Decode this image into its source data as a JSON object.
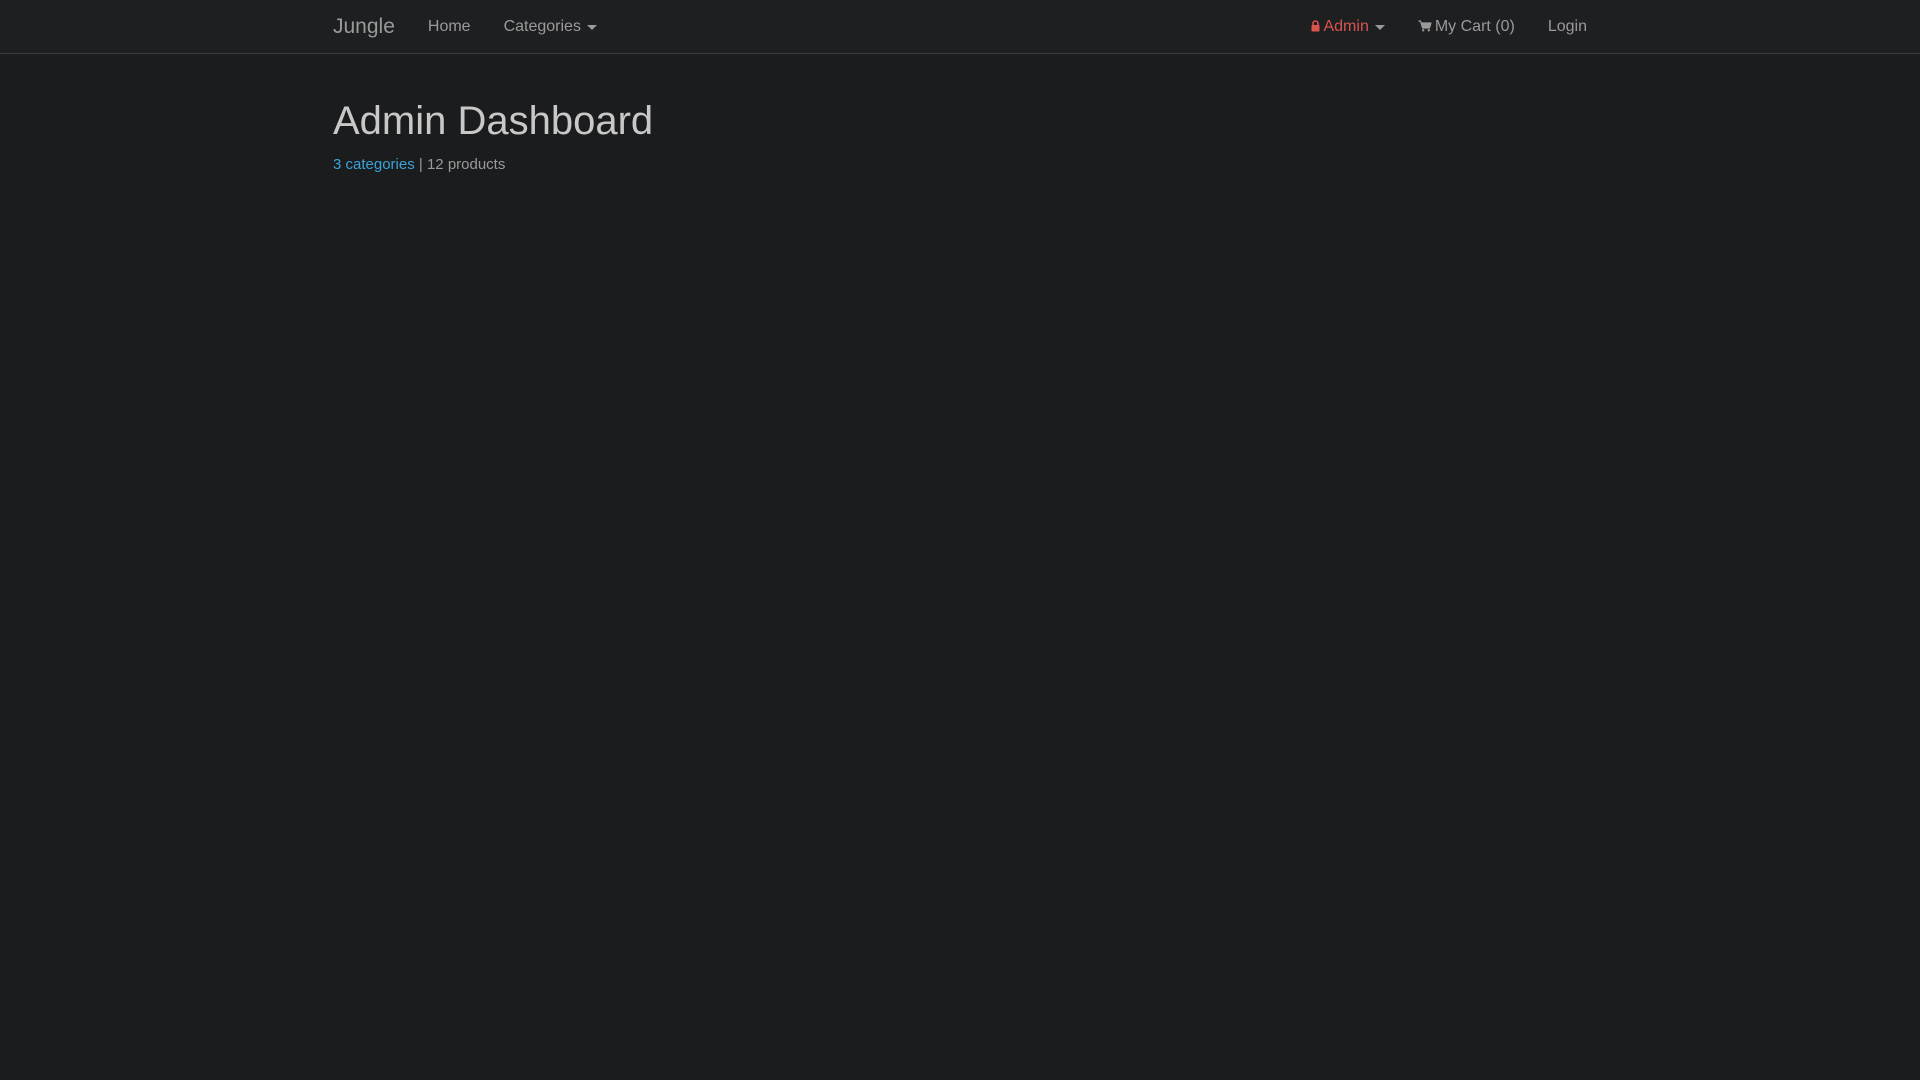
{
  "navbar": {
    "brand": "Jungle",
    "home": "Home",
    "categories": "Categories",
    "admin": "Admin",
    "cart": "My Cart (0)",
    "login": "Login"
  },
  "main": {
    "title": "Admin Dashboard",
    "categories_link": "3 categories",
    "separator": "|",
    "products": "12 products"
  },
  "icons": {
    "lock": "lock-icon",
    "cart": "shopping-cart-icon",
    "caret": "caret-down-icon"
  },
  "colors": {
    "background": "#1b1c1e",
    "navbar": "#1e1f21",
    "admin": "#d9534f",
    "link": "#3aa3d6",
    "text_muted": "#9a9a9a",
    "title": "#c8c8c8"
  }
}
